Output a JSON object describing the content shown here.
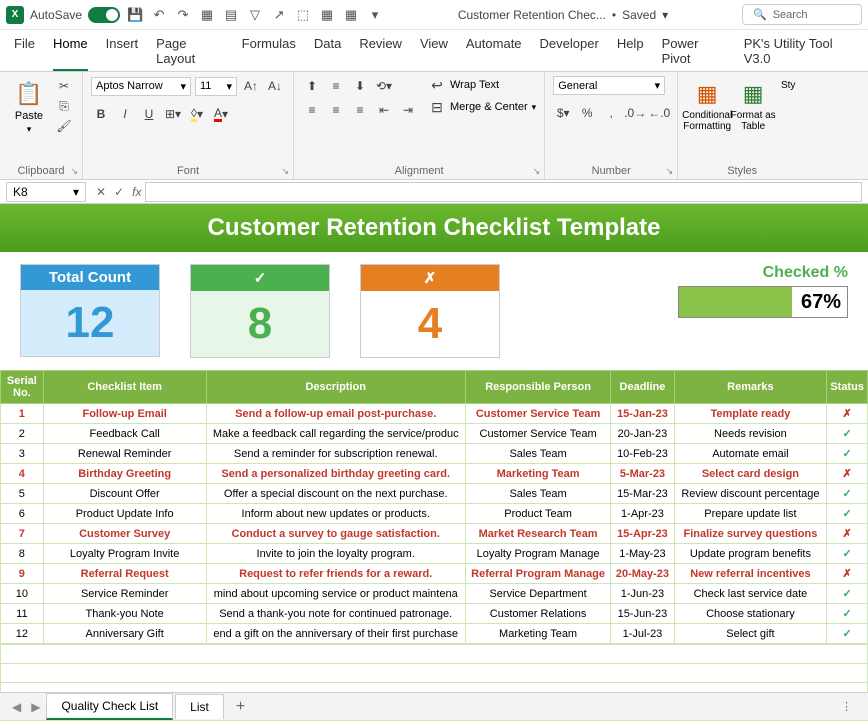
{
  "titlebar": {
    "autosave": "AutoSave",
    "filename": "Customer Retention Chec...",
    "saved": "Saved",
    "search": "Search"
  },
  "tabs": [
    "File",
    "Home",
    "Insert",
    "Page Layout",
    "Formulas",
    "Data",
    "Review",
    "View",
    "Automate",
    "Developer",
    "Help",
    "Power Pivot",
    "PK's Utility Tool V3.0"
  ],
  "ribbon": {
    "clipboard": "Clipboard",
    "paste": "Paste",
    "font": "Font",
    "font_name": "Aptos Narrow",
    "font_size": "11",
    "alignment": "Alignment",
    "wrap": "Wrap Text",
    "merge": "Merge & Center",
    "number": "Number",
    "num_format": "General",
    "styles": "Styles",
    "cond_fmt": "Conditional Formatting",
    "fmt_table": "Format as Table",
    "cell_styles": "Sty"
  },
  "namebox": "K8",
  "sheet": {
    "title": "Customer Retention Checklist Template",
    "total_label": "Total Count",
    "total": "12",
    "check": "✓",
    "check_count": "8",
    "cross": "✗",
    "cross_count": "4",
    "checked_label": "Checked %",
    "checked_pct": "67%",
    "checked_pct_num": 67,
    "headers": [
      "Serial No.",
      "Checklist Item",
      "Description",
      "Responsible Person",
      "Deadline",
      "Remarks",
      "Status"
    ],
    "rows": [
      {
        "n": "1",
        "item": "Follow-up Email",
        "desc": "Send a follow-up email post-purchase.",
        "person": "Customer Service Team",
        "dead": "15-Jan-23",
        "rem": "Template ready",
        "ok": false
      },
      {
        "n": "2",
        "item": "Feedback Call",
        "desc": "Make a feedback call regarding the service/produc",
        "person": "Customer Service Team",
        "dead": "20-Jan-23",
        "rem": "Needs revision",
        "ok": true
      },
      {
        "n": "3",
        "item": "Renewal Reminder",
        "desc": "Send a reminder for subscription renewal.",
        "person": "Sales Team",
        "dead": "10-Feb-23",
        "rem": "Automate email",
        "ok": true
      },
      {
        "n": "4",
        "item": "Birthday Greeting",
        "desc": "Send a personalized birthday greeting card.",
        "person": "Marketing Team",
        "dead": "5-Mar-23",
        "rem": "Select card design",
        "ok": false
      },
      {
        "n": "5",
        "item": "Discount Offer",
        "desc": "Offer a special discount on the next purchase.",
        "person": "Sales Team",
        "dead": "15-Mar-23",
        "rem": "Review discount percentage",
        "ok": true
      },
      {
        "n": "6",
        "item": "Product Update Info",
        "desc": "Inform about new updates or products.",
        "person": "Product Team",
        "dead": "1-Apr-23",
        "rem": "Prepare update list",
        "ok": true
      },
      {
        "n": "7",
        "item": "Customer Survey",
        "desc": "Conduct a survey to gauge satisfaction.",
        "person": "Market Research Team",
        "dead": "15-Apr-23",
        "rem": "Finalize survey questions",
        "ok": false
      },
      {
        "n": "8",
        "item": "Loyalty Program Invite",
        "desc": "Invite to join the loyalty program.",
        "person": "Loyalty Program Manage",
        "dead": "1-May-23",
        "rem": "Update program benefits",
        "ok": true
      },
      {
        "n": "9",
        "item": "Referral Request",
        "desc": "Request to refer friends for a reward.",
        "person": "Referral Program Manage",
        "dead": "20-May-23",
        "rem": "New referral incentives",
        "ok": false
      },
      {
        "n": "10",
        "item": "Service Reminder",
        "desc": "mind about upcoming service or product maintena",
        "person": "Service Department",
        "dead": "1-Jun-23",
        "rem": "Check last service date",
        "ok": true
      },
      {
        "n": "11",
        "item": "Thank-you Note",
        "desc": "Send a thank-you note for continued patronage.",
        "person": "Customer Relations",
        "dead": "15-Jun-23",
        "rem": "Choose stationary",
        "ok": true
      },
      {
        "n": "12",
        "item": "Anniversary Gift",
        "desc": "end a gift on the anniversary of their first purchase",
        "person": "Marketing Team",
        "dead": "1-Jul-23",
        "rem": "Select gift",
        "ok": true
      }
    ]
  },
  "tabs_bottom": {
    "tab1": "Quality Check List",
    "tab2": "List"
  }
}
